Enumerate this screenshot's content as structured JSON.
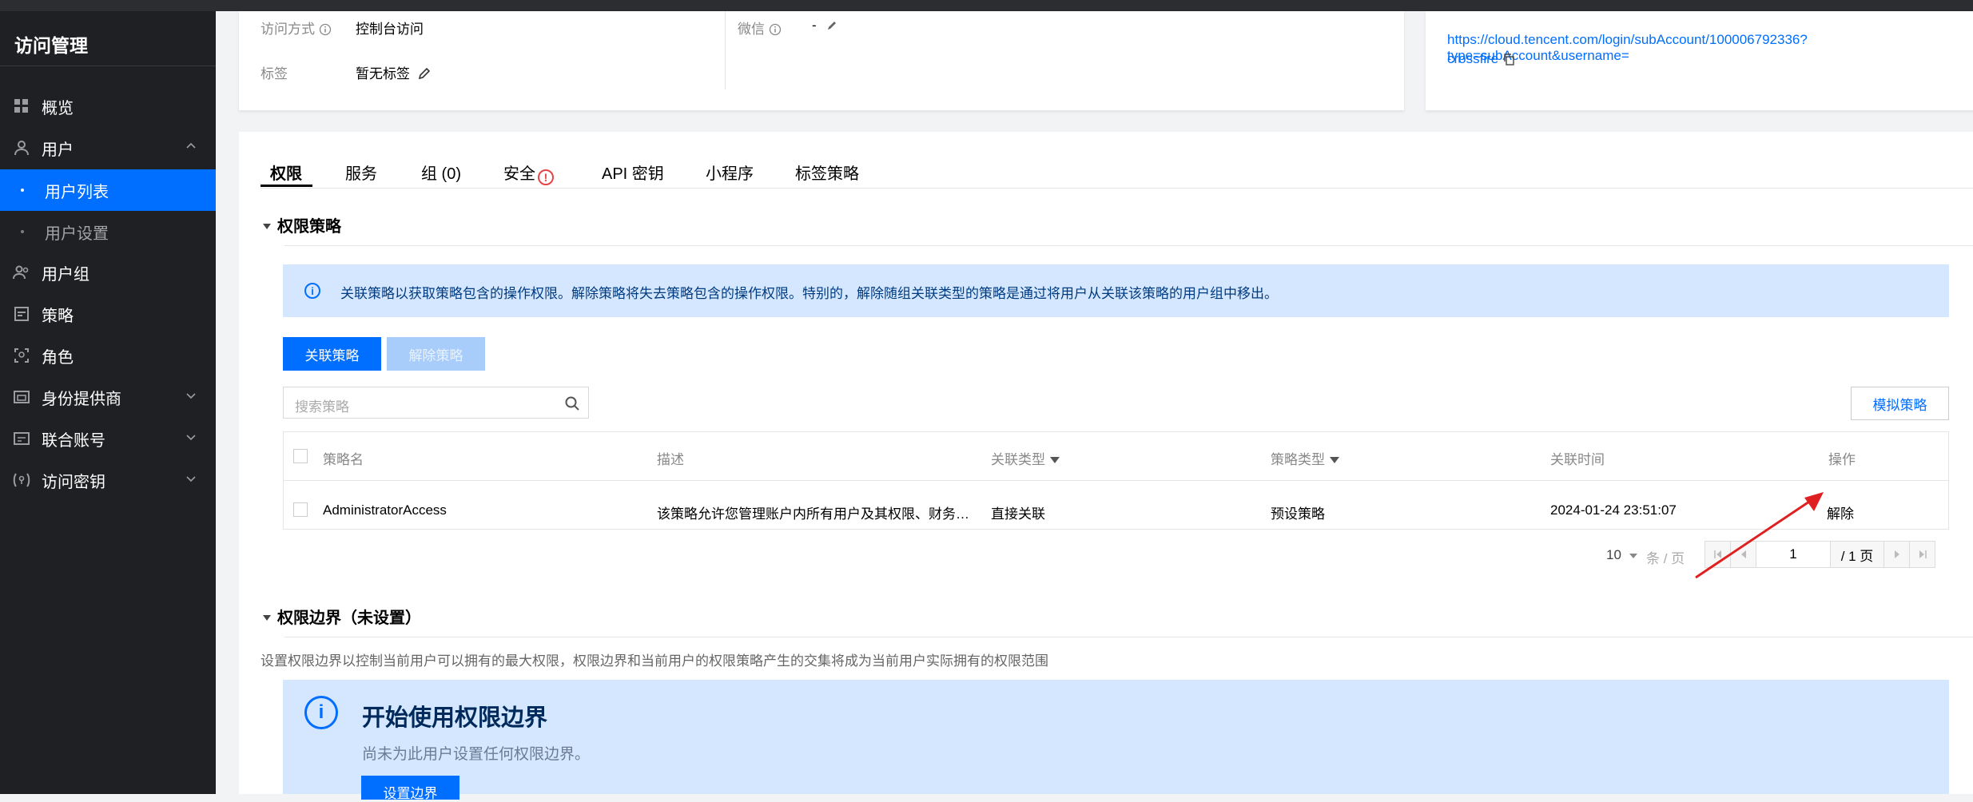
{
  "sidebar": {
    "title": "访问管理",
    "items": [
      {
        "label": "概览",
        "icon": "grid-icon"
      },
      {
        "label": "用户",
        "icon": "user-icon"
      },
      {
        "label": "用户列表"
      },
      {
        "label": "用户设置"
      },
      {
        "label": "用户组",
        "icon": "user-group-icon"
      },
      {
        "label": "策略",
        "icon": "policy-icon"
      },
      {
        "label": "角色",
        "icon": "role-icon"
      },
      {
        "label": "身份提供商",
        "icon": "idp-icon"
      },
      {
        "label": "联合账号",
        "icon": "federated-account-icon"
      },
      {
        "label": "访问密钥",
        "icon": "key-icon"
      }
    ]
  },
  "user_info": {
    "access_method_label": "访问方式",
    "access_method_value": "控制台访问",
    "wechat_label": "微信",
    "wechat_value": "-",
    "tags_label": "标签",
    "tags_value": "暂无标签",
    "login_url_line1": "https://cloud.tencent.com/login/subAccount/100006792336?type=subAccount&username=",
    "login_url_line2": "crossfire"
  },
  "tabs": [
    "权限",
    "服务",
    "组 (0)",
    "安全",
    "API 密钥",
    "小程序",
    "标签策略"
  ],
  "permission_policy": {
    "title": "权限策略",
    "notice": "关联策略以获取策略包含的操作权限。解除策略将失去策略包含的操作权限。特别的，解除随组关联类型的策略是通过将用户从关联该策略的用户组中移出。",
    "attach_button": "关联策略",
    "detach_button": "解除策略",
    "search_placeholder": "搜索策略",
    "simulate_button": "模拟策略",
    "columns": [
      "策略名",
      "描述",
      "关联类型",
      "策略类型",
      "关联时间",
      "操作"
    ],
    "rows": [
      {
        "name": "AdministratorAccess",
        "description": "该策略允许您管理账户内所有用户及其权限、财务…",
        "association_type": "直接关联",
        "policy_type": "预设策略",
        "time": "2024-01-24 23:51:07",
        "action": "解除"
      }
    ],
    "pagination": {
      "page_size": "10",
      "page_size_unit": "条 / 页",
      "current_page": "1",
      "total_pages": "/ 1 页"
    }
  },
  "permission_boundary": {
    "title": "权限边界（未设置）",
    "description": "设置权限边界以控制当前用户可以拥有的最大权限，权限边界和当前用户的权限策略产生的交集将成为当前用户实际拥有的权限范围",
    "banner_title": "开始使用权限边界",
    "banner_subtitle": "尚未为此用户设置任何权限边界。",
    "set_button": "设置边界"
  },
  "colors": {
    "accent": "#006eff",
    "sidebar_bg": "#1f2023",
    "notice_bg": "#d5e7ff",
    "annotation_arrow": "#e02020"
  }
}
